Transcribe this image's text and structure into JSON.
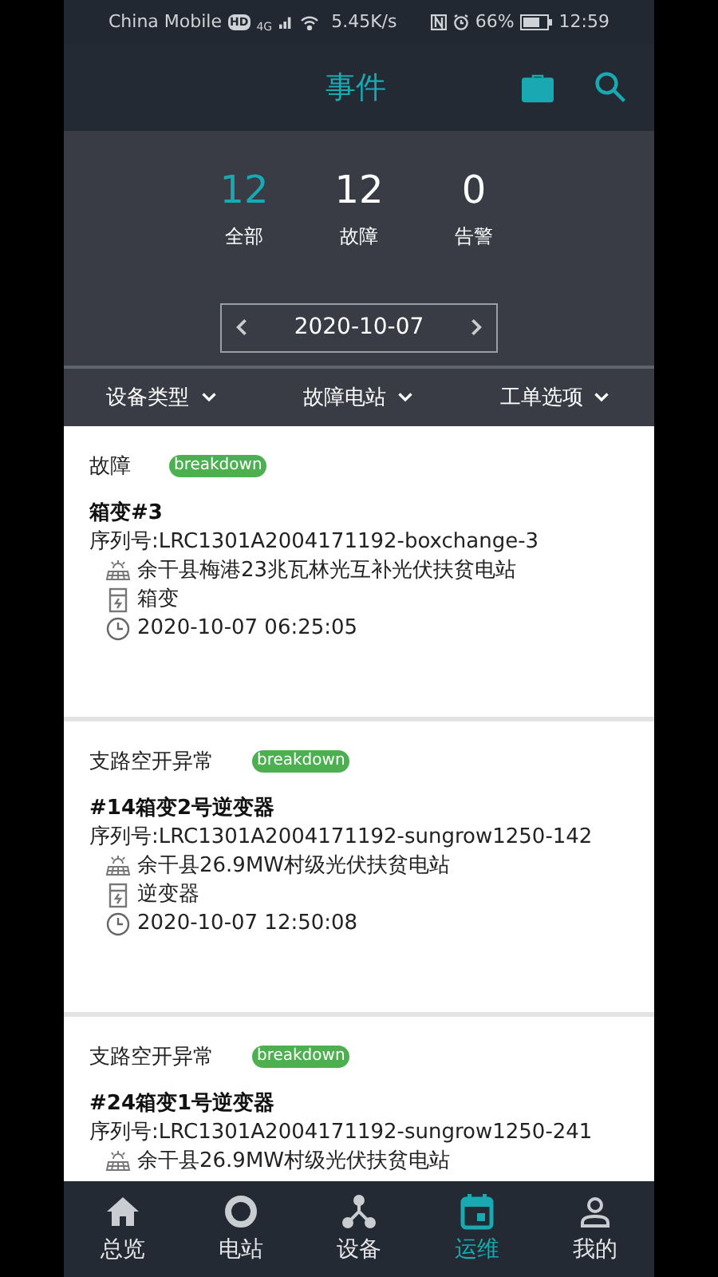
{
  "status_bar": {
    "carrier": "China Mobile",
    "hd": "HD",
    "network": "4G",
    "speed": "5.45K/s",
    "battery": "66%",
    "time": "12:59"
  },
  "header": {
    "title": "事件"
  },
  "stats": [
    {
      "value": "12",
      "label": "全部",
      "selected": true
    },
    {
      "value": "12",
      "label": "故障",
      "selected": false
    },
    {
      "value": "0",
      "label": "告警",
      "selected": false
    }
  ],
  "date": "2020-10-07",
  "filters": [
    "设备类型",
    "故障电站",
    "工单选项"
  ],
  "events": [
    {
      "type": "故障",
      "badge": "breakdown",
      "name": "箱变#3",
      "serial": "序列号:LRC1301A2004171192-boxchange-3",
      "station": "余干县梅港23兆瓦林光互补光伏扶贫电站",
      "device": "箱变",
      "time": "2020-10-07 06:25:05"
    },
    {
      "type": "支路空开异常",
      "badge": "breakdown",
      "name": "#14箱变2号逆变器",
      "serial": "序列号:LRC1301A2004171192-sungrow1250-142",
      "station": "余干县26.9MW村级光伏扶贫电站",
      "device": "逆变器",
      "time": "2020-10-07 12:50:08"
    },
    {
      "type": "支路空开异常",
      "badge": "breakdown",
      "name": "#24箱变1号逆变器",
      "serial": "序列号:LRC1301A2004171192-sungrow1250-241",
      "station": "余干县26.9MW村级光伏扶贫电站"
    }
  ],
  "nav": [
    {
      "label": "总览",
      "selected": false
    },
    {
      "label": "电站",
      "selected": false
    },
    {
      "label": "设备",
      "selected": false
    },
    {
      "label": "运维",
      "selected": true
    },
    {
      "label": "我的",
      "selected": false
    }
  ]
}
